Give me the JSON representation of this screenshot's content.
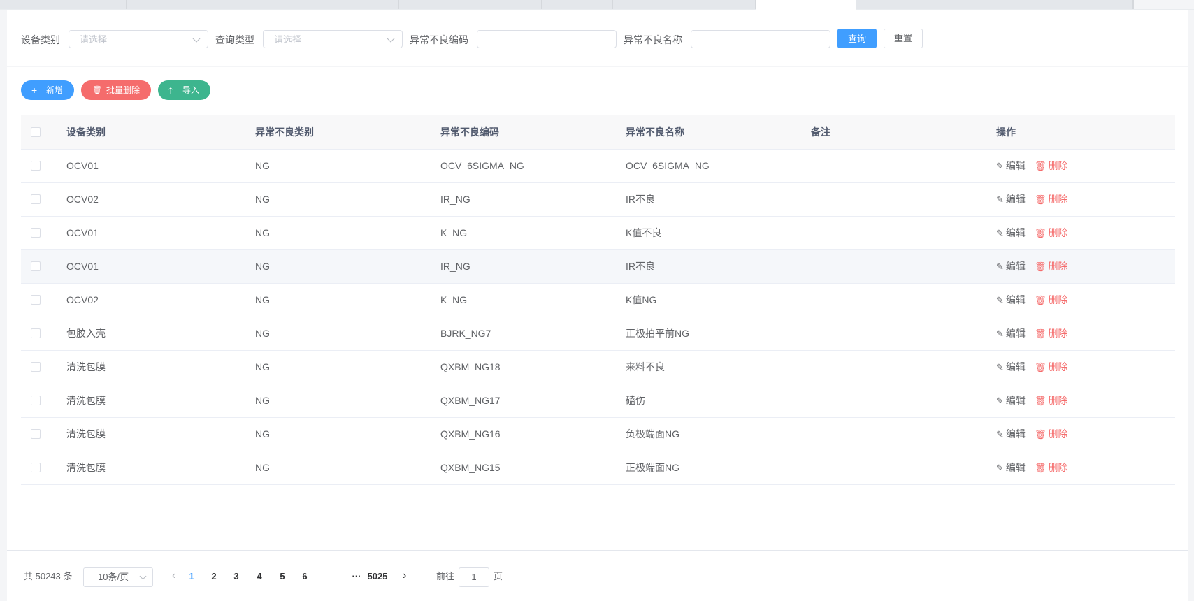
{
  "filter": {
    "device_type_label": "设备类别",
    "device_type_placeholder": "请选择",
    "query_type_label": "查询类型",
    "query_type_placeholder": "请选择",
    "code_label": "异常不良编码",
    "code_value": "",
    "name_label": "异常不良名称",
    "name_value": "",
    "query_btn": "查询",
    "reset_btn": "重置"
  },
  "actions": {
    "add": {
      "icon": "+",
      "label": "新增"
    },
    "batch_delete": {
      "icon": "🗑",
      "label": "批量删除"
    },
    "import": {
      "icon": "⤒",
      "label": "导入"
    }
  },
  "table": {
    "headers": {
      "device_type": "设备类别",
      "abnormal_type": "异常不良类别",
      "code": "异常不良编码",
      "name": "异常不良名称",
      "remark": "备注",
      "ops": "操作"
    },
    "edit_label": "编辑",
    "delete_label": "删除",
    "rows": [
      {
        "device_type": "OCV01",
        "abnormal_type": "NG",
        "code": "OCV_6SIGMA_NG",
        "name": "OCV_6SIGMA_NG",
        "remark": ""
      },
      {
        "device_type": "OCV02",
        "abnormal_type": "NG",
        "code": "IR_NG",
        "name": "IR不良",
        "remark": ""
      },
      {
        "device_type": "OCV01",
        "abnormal_type": "NG",
        "code": "K_NG",
        "name": "K值不良",
        "remark": ""
      },
      {
        "device_type": "OCV01",
        "abnormal_type": "NG",
        "code": "IR_NG",
        "name": "IR不良",
        "remark": ""
      },
      {
        "device_type": "OCV02",
        "abnormal_type": "NG",
        "code": "K_NG",
        "name": "K值NG",
        "remark": ""
      },
      {
        "device_type": "包胶入壳",
        "abnormal_type": "NG",
        "code": "BJRK_NG7",
        "name": "正极拍平前NG",
        "remark": ""
      },
      {
        "device_type": "清洗包膜",
        "abnormal_type": "NG",
        "code": "QXBM_NG18",
        "name": "来料不良",
        "remark": ""
      },
      {
        "device_type": "清洗包膜",
        "abnormal_type": "NG",
        "code": "QXBM_NG17",
        "name": "磕伤",
        "remark": ""
      },
      {
        "device_type": "清洗包膜",
        "abnormal_type": "NG",
        "code": "QXBM_NG16",
        "name": "负极端面NG",
        "remark": ""
      },
      {
        "device_type": "清洗包膜",
        "abnormal_type": "NG",
        "code": "QXBM_NG15",
        "name": "正极端面NG",
        "remark": ""
      }
    ]
  },
  "pagination": {
    "total": "共 50243 条",
    "page_size": "10条/页",
    "pages": [
      "1",
      "2",
      "3",
      "4",
      "5",
      "6"
    ],
    "ellipsis": "···",
    "last_page": "5025",
    "current": "1",
    "goto_prefix": "前往",
    "goto_value": "1",
    "goto_suffix": "页"
  },
  "colors": {
    "primary": "#409eff",
    "danger": "#f56c6c",
    "success": "#3db58e"
  }
}
